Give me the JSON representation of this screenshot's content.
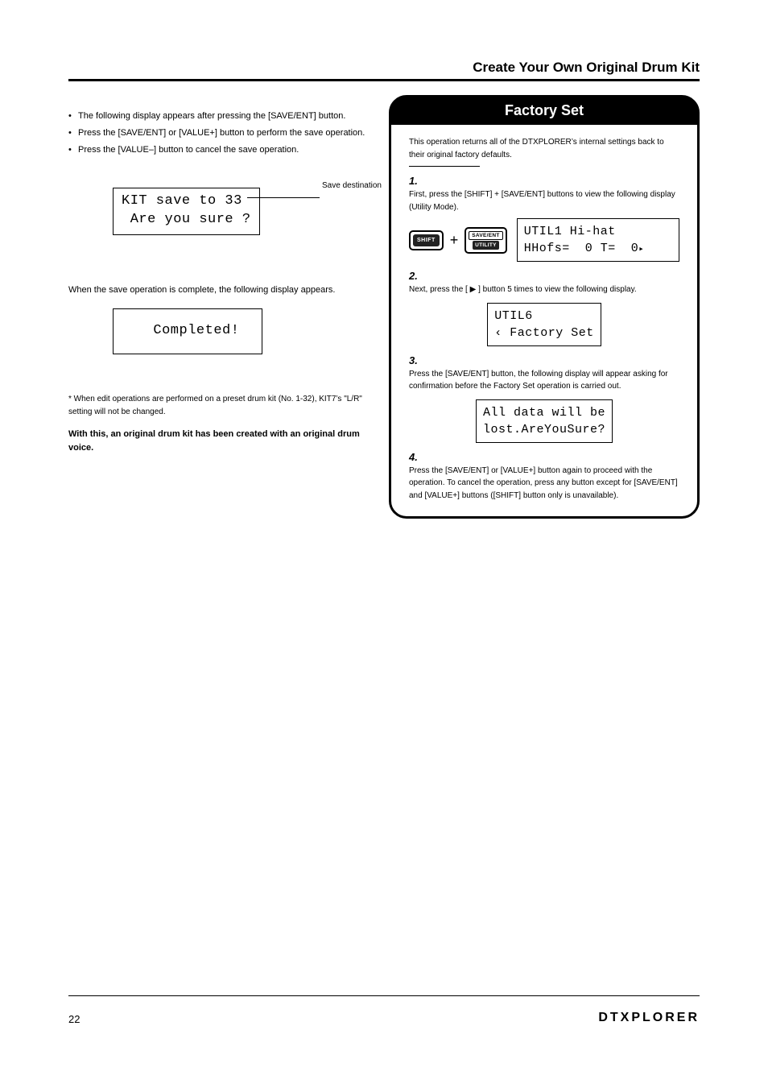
{
  "header": {
    "title": "Create Your Own Original Drum Kit"
  },
  "left": {
    "p1_a": "The following display appears after pressing the [SAVE/ENT] button.",
    "p1_b": "Press the [SAVE/ENT] or [VALUE+] button to perform the save operation.",
    "p1_c": "Press the [VALUE–] button to cancel the save operation.",
    "lcd1_l1": "KIT save to 33",
    "lcd1_l2": " Are you sure ?",
    "dest_label": "Save destination",
    "p2": "When the save operation is complete, the following display appears.",
    "lcd2_l1": "  Completed!",
    "note_a": "* When edit operations are performed on a preset drum kit (No. 1-32), KIT7’s \"L/R\" setting will not be changed.",
    "note_b": "With this, an original drum kit has been created with an original drum voice."
  },
  "right": {
    "title": "Factory Set",
    "intro": "This operation returns all of the DTXPLORER’s internal settings back to their original factory defaults.",
    "s1_num": "1.",
    "s1_text": "First, press the [SHIFT] + [SAVE/ENT] buttons to view the following display (Utility Mode).",
    "btn_shift": "SHIFT",
    "btn_save": "SAVE/ENT",
    "btn_util": "UTILITY",
    "lcd_s1_l1": "UTIL1 Hi-hat",
    "lcd_s1_l2": "HHofs=  0 T=  0",
    "s2_num": "2.",
    "s2_text": "Next, press the [    ] button 5 times to view the following display.",
    "lcd_s2_l1": "UTIL6",
    "lcd_s2_l2": "‹ Factory Set",
    "s3_num": "3.",
    "s3_text": "Press the [SAVE/ENT] button, the following display will appear asking for confirmation before the Factory Set operation is carried out.",
    "lcd_s3_l1": "All data will be",
    "lcd_s3_l2": "lost.AreYouSure?",
    "s4_num": "4.",
    "s4_text": "Press the [SAVE/ENT] or [VALUE+] button again to proceed with the operation. To cancel the operation, press any button except for [SAVE/ENT] and [VALUE+] buttons ([SHIFT] button only is unavailable)."
  },
  "footer": {
    "page": "22",
    "logo": "DTXPLORER"
  }
}
